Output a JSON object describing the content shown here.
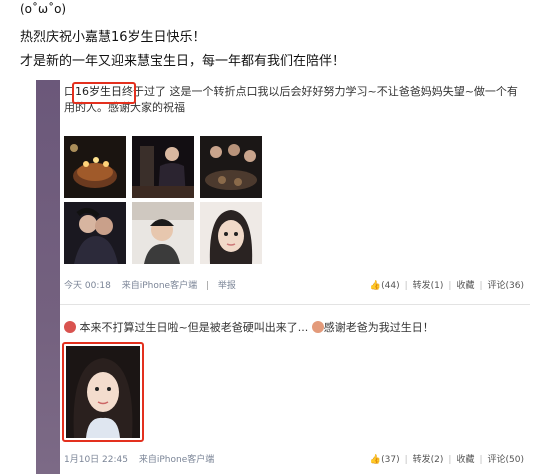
{
  "intro": {
    "line1": "(o˚ω˚o)",
    "line2": "热烈庆祝小嘉慧16岁生日快乐！",
    "line3": "才是新的一年又迎来慧宝生日，每一年都有我们在陪伴！"
  },
  "post1": {
    "text_prefix": "口",
    "highlight": "16岁生日",
    "text_rest": "终于过了 这是一个转折点口我以后会好好努力学习~不让爸爸妈妈失望~做一个有用的人。感谢大家的祝福",
    "meta": {
      "time": "今天 00:18",
      "source": "来自iPhone客户端",
      "report": "举报"
    },
    "actions": {
      "like": "(44)",
      "forward": "转发(1)",
      "favorite": "收藏",
      "comment": "评论(36)"
    }
  },
  "post2": {
    "text_a": "本来不打算过生日啦~但是被老爸硬叫出来了...",
    "text_b": "感谢老爸为我过生日！",
    "meta": {
      "time": "1月10日 22:45",
      "source": "来自iPhone客户端"
    },
    "actions": {
      "like": "(37)",
      "forward": "转发(2)",
      "favorite": "收藏",
      "comment": "评论(50)"
    }
  },
  "colors": {
    "highlight_box": "#e3301e",
    "sidebar": "#6d5b79",
    "link": "#2f64a8"
  }
}
